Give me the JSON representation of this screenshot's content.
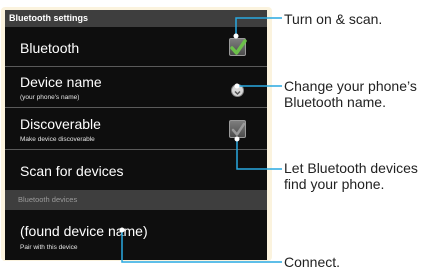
{
  "screen": {
    "title": "Bluetooth settings"
  },
  "settings": {
    "bluetooth": {
      "label": "Bluetooth",
      "checked": true
    },
    "device_name": {
      "label": "Device name",
      "sub": "(your phone's name)"
    },
    "discoverable": {
      "label": "Discoverable",
      "sub": "Make device discoverable",
      "checked": false
    },
    "scan": {
      "label": "Scan for devices"
    }
  },
  "devices_section": {
    "header": "Bluetooth devices",
    "found": {
      "label": "(found device name)",
      "sub": "Pair with this device"
    }
  },
  "callouts": {
    "turn_on": "Turn on & scan.",
    "change_name": "Change your phone’s Bluetooth name.",
    "let_find": "Let Bluetooth devices find your phone.",
    "connect": "Connect."
  },
  "colors": {
    "callout_line": "#29a9e0",
    "check": "#6cc04a",
    "screen_bg": "#0e0e0e",
    "bezel": "#fbf3de"
  }
}
